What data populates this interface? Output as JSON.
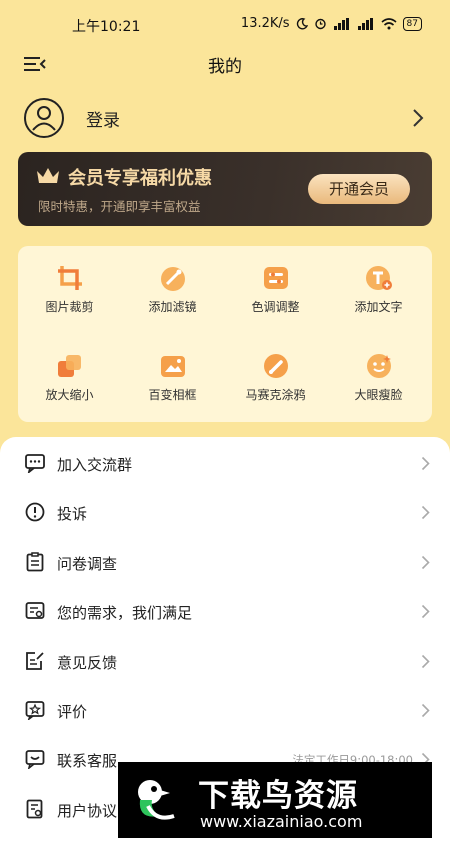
{
  "status_bar": {
    "time": "上午10:21",
    "net_speed": "13.2K/s",
    "battery": "87"
  },
  "header": {
    "title": "我的",
    "menu_icon": "menu-collapse-icon"
  },
  "account": {
    "login_label": "登录",
    "avatar_icon": "user-avatar-icon"
  },
  "vip": {
    "title": "会员专享福利优惠",
    "subtitle": "限时特惠，开通即享丰富权益",
    "button_label": "开通会员",
    "colors": {
      "banner": "#2b2420",
      "gold_text": "#f6d9a6",
      "button": "#e9b97c"
    }
  },
  "tools": [
    {
      "label": "图片裁剪",
      "icon": "crop-icon"
    },
    {
      "label": "添加滤镜",
      "icon": "filter-icon"
    },
    {
      "label": "色调调整",
      "icon": "tone-adjust-icon"
    },
    {
      "label": "添加文字",
      "icon": "add-text-icon"
    },
    {
      "label": "放大缩小",
      "icon": "zoom-icon"
    },
    {
      "label": "百变相框",
      "icon": "photo-frame-icon"
    },
    {
      "label": "马赛克涂鸦",
      "icon": "mosaic-brush-icon"
    },
    {
      "label": "大眼瘦脸",
      "icon": "face-beauty-icon"
    }
  ],
  "menu": [
    {
      "label": "加入交流群",
      "icon": "chat-group-icon"
    },
    {
      "label": "投诉",
      "icon": "alert-icon"
    },
    {
      "label": "问卷调查",
      "icon": "clipboard-icon"
    },
    {
      "label": "您的需求，我们满足",
      "icon": "request-icon"
    },
    {
      "label": "意见反馈",
      "icon": "feedback-icon"
    },
    {
      "label": "评价",
      "icon": "rating-icon"
    },
    {
      "label": "联系客服",
      "icon": "customer-service-icon",
      "note": "法定工作日9:00-18:00"
    },
    {
      "label": "用户协议",
      "icon": "agreement-icon"
    }
  ],
  "watermark": {
    "title": "下载鸟资源",
    "url": "www.xiazainiao.com"
  },
  "colors": {
    "background": "#fbe59a",
    "tool_card": "#fff6d6",
    "icon_orange": "#f5a04a"
  }
}
